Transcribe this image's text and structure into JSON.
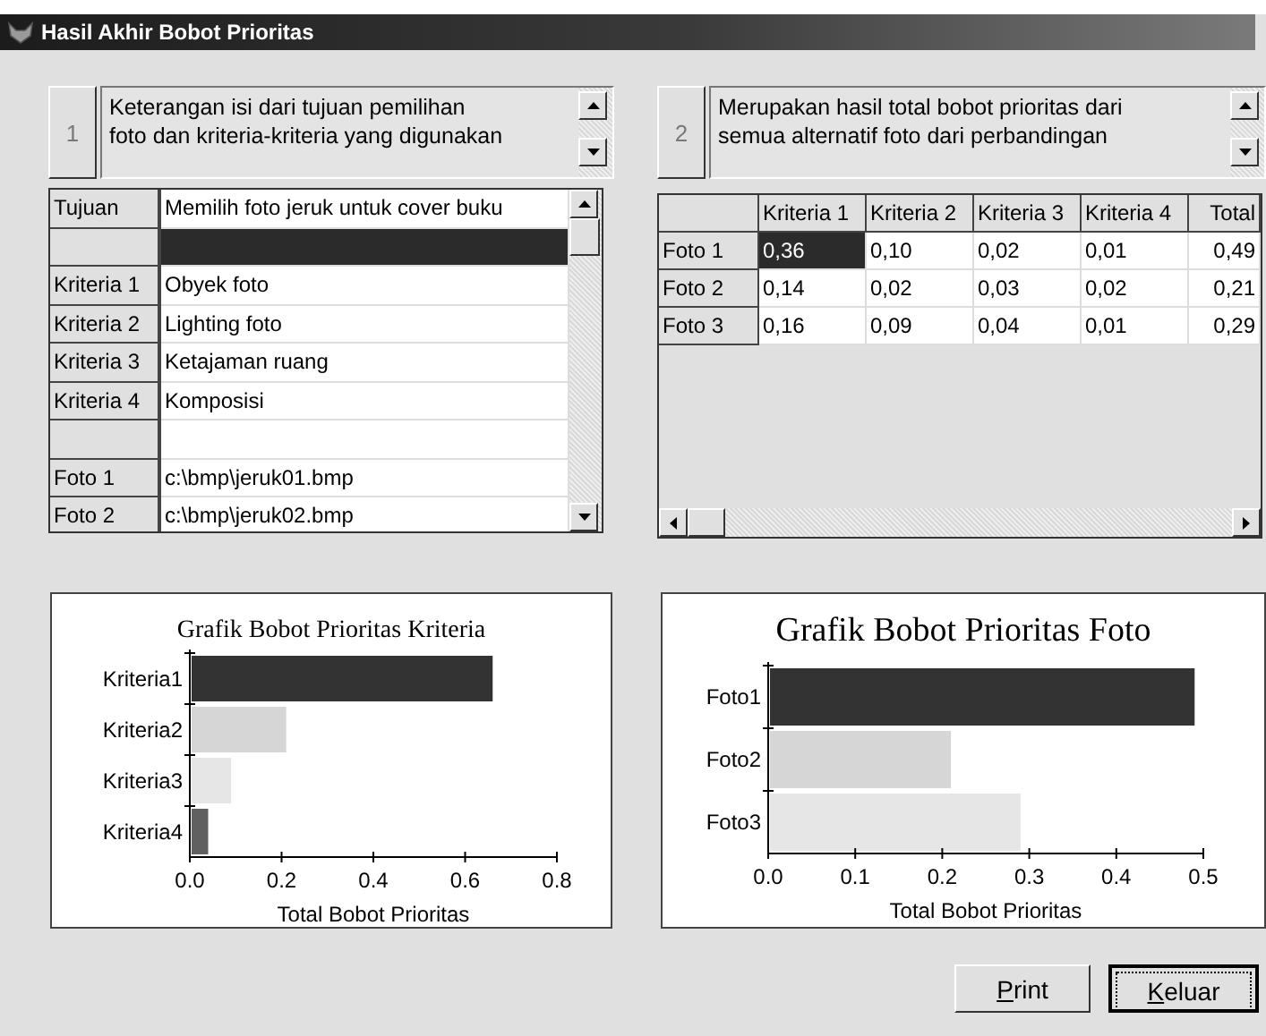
{
  "window": {
    "title": "Hasil Akhir Bobot Prioritas"
  },
  "left_panel": {
    "step": {
      "label": "1",
      "disabled": true
    },
    "note": [
      "Keterangan isi dari tujuan pemilihan",
      "foto dan kriteria-kriteria yang digunakan"
    ],
    "grid": {
      "rows": [
        {
          "label": "Tujuan",
          "value": "Memilih foto jeruk untuk cover buku",
          "selected": false
        },
        {
          "selected": true
        },
        {
          "label": "Kriteria 1",
          "value": "Obyek foto",
          "selected": false
        },
        {
          "label": "Kriteria 2",
          "value": "Lighting foto",
          "selected": false
        },
        {
          "label": "Kriteria 3",
          "value": "Ketajaman ruang",
          "selected": false
        },
        {
          "label": "Kriteria 4",
          "value": "Komposisi",
          "selected": false
        },
        {
          "selected": false
        },
        {
          "label": "Foto 1",
          "value": "c:\\bmp\\jeruk01.bmp",
          "selected": false
        },
        {
          "label": "Foto 2",
          "value": "c:\\bmp\\jeruk02.bmp",
          "selected": false
        }
      ]
    }
  },
  "right_panel": {
    "step": {
      "label": "2",
      "disabled": true
    },
    "note": [
      "Merupakan hasil total bobot prioritas dari",
      "semua alternatif foto dari perbandingan"
    ],
    "grid": {
      "columns": [
        "Kriteria 1",
        "Kriteria 2",
        "Kriteria 3",
        "Kriteria 4",
        "Total"
      ],
      "rows": [
        {
          "label": "Foto 1",
          "cells": [
            {
              "value": "0,36",
              "selected": true
            },
            {
              "value": "0,10",
              "selected": false
            },
            {
              "value": "0,02",
              "selected": false
            },
            {
              "value": "0,01",
              "selected": false
            },
            {
              "value": "0,49",
              "selected": false
            }
          ]
        },
        {
          "label": "Foto 2",
          "cells": [
            {
              "value": "0,14",
              "selected": false
            },
            {
              "value": "0,02",
              "selected": false
            },
            {
              "value": "0,03",
              "selected": false
            },
            {
              "value": "0,02",
              "selected": false
            },
            {
              "value": "0,21",
              "selected": false
            }
          ]
        },
        {
          "label": "Foto 3",
          "cells": [
            {
              "value": "0,16",
              "selected": false
            },
            {
              "value": "0,09",
              "selected": false
            },
            {
              "value": "0,04",
              "selected": false
            },
            {
              "value": "0,01",
              "selected": false
            },
            {
              "value": "0,29",
              "selected": false
            }
          ]
        }
      ]
    }
  },
  "charts": [
    {
      "chart_data": {
        "type": "bar",
        "orientation": "horizontal",
        "title": "Grafik Bobot Prioritas Kriteria",
        "xlabel": "Total Bobot Prioritas",
        "categories": [
          "Kriteria1",
          "Kriteria2",
          "Kriteria3",
          "Kriteria4"
        ],
        "series": [
          {
            "values": [
              0.66,
              0.21,
              0.09,
              0.04
            ]
          }
        ],
        "colors": [
          "#333333",
          "#d6d6d6",
          "#e6e6e6",
          "#606060"
        ],
        "xlim": [
          0,
          0.8
        ],
        "xticks": [
          {
            "value": 0,
            "label": "0.0"
          },
          {
            "value": 0.2,
            "label": "0.2"
          },
          {
            "value": 0.4,
            "label": "0.4"
          },
          {
            "value": 0.6,
            "label": "0.6"
          },
          {
            "value": 0.8,
            "label": "0.8"
          }
        ]
      }
    },
    {
      "chart_data": {
        "type": "bar",
        "orientation": "horizontal",
        "title": "Grafik Bobot Prioritas Foto",
        "xlabel": "Total Bobot Prioritas",
        "categories": [
          "Foto1",
          "Foto2",
          "Foto3"
        ],
        "series": [
          {
            "values": [
              0.49,
              0.21,
              0.29
            ]
          }
        ],
        "colors": [
          "#333333",
          "#d6d6d6",
          "#e6e6e6"
        ],
        "xlim": [
          0,
          0.5
        ],
        "xticks": [
          {
            "value": 0,
            "label": "0.0"
          },
          {
            "value": 0.1,
            "label": "0.1"
          },
          {
            "value": 0.2,
            "label": "0.2"
          },
          {
            "value": 0.3,
            "label": "0.3"
          },
          {
            "value": 0.4,
            "label": "0.4"
          },
          {
            "value": 0.5,
            "label": "0.5"
          }
        ]
      }
    }
  ],
  "buttons": [
    {
      "label": "Print",
      "underline_first": true,
      "focused": false
    },
    {
      "label": "Keluar",
      "underline_first": true,
      "focused": true
    }
  ]
}
